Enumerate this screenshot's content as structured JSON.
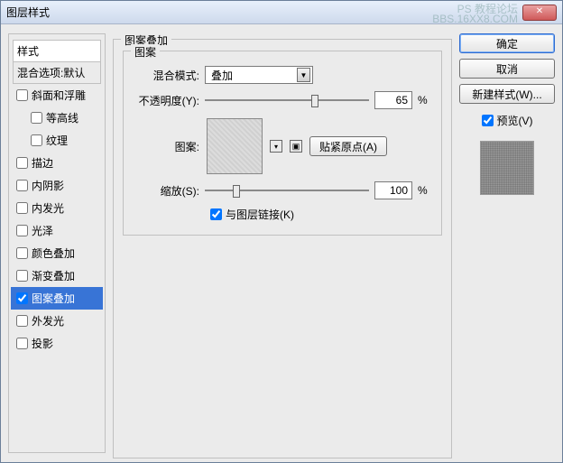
{
  "window": {
    "title": "图层样式"
  },
  "watermark": {
    "line1": "PS 教程论坛",
    "line2": "BBS.16XX8.COM"
  },
  "styles": {
    "heading": "样式",
    "subheading": "混合选项:默认",
    "items": [
      {
        "label": "斜面和浮雕",
        "checked": false,
        "indent": false
      },
      {
        "label": "等高线",
        "checked": false,
        "indent": true
      },
      {
        "label": "纹理",
        "checked": false,
        "indent": true
      },
      {
        "label": "描边",
        "checked": false,
        "indent": false
      },
      {
        "label": "内阴影",
        "checked": false,
        "indent": false
      },
      {
        "label": "内发光",
        "checked": false,
        "indent": false
      },
      {
        "label": "光泽",
        "checked": false,
        "indent": false
      },
      {
        "label": "颜色叠加",
        "checked": false,
        "indent": false
      },
      {
        "label": "渐变叠加",
        "checked": false,
        "indent": false
      },
      {
        "label": "图案叠加",
        "checked": true,
        "indent": false,
        "selected": true
      },
      {
        "label": "外发光",
        "checked": false,
        "indent": false
      },
      {
        "label": "投影",
        "checked": false,
        "indent": false
      }
    ]
  },
  "centerGroup": {
    "title": "图案叠加",
    "innerTitle": "图案",
    "blendModeLabel": "混合模式:",
    "blendModeValue": "叠加",
    "opacityLabel": "不透明度(Y):",
    "opacityValue": "65",
    "opacityUnit": "%",
    "patternLabel": "图案:",
    "snapButton": "贴紧原点(A)",
    "scaleLabel": "缩放(S):",
    "scaleValue": "100",
    "scaleUnit": "%",
    "linkLabel": "与图层链接(K)",
    "linkChecked": true
  },
  "right": {
    "ok": "确定",
    "cancel": "取消",
    "newStyle": "新建样式(W)...",
    "previewLabel": "预览(V)",
    "previewChecked": true
  }
}
